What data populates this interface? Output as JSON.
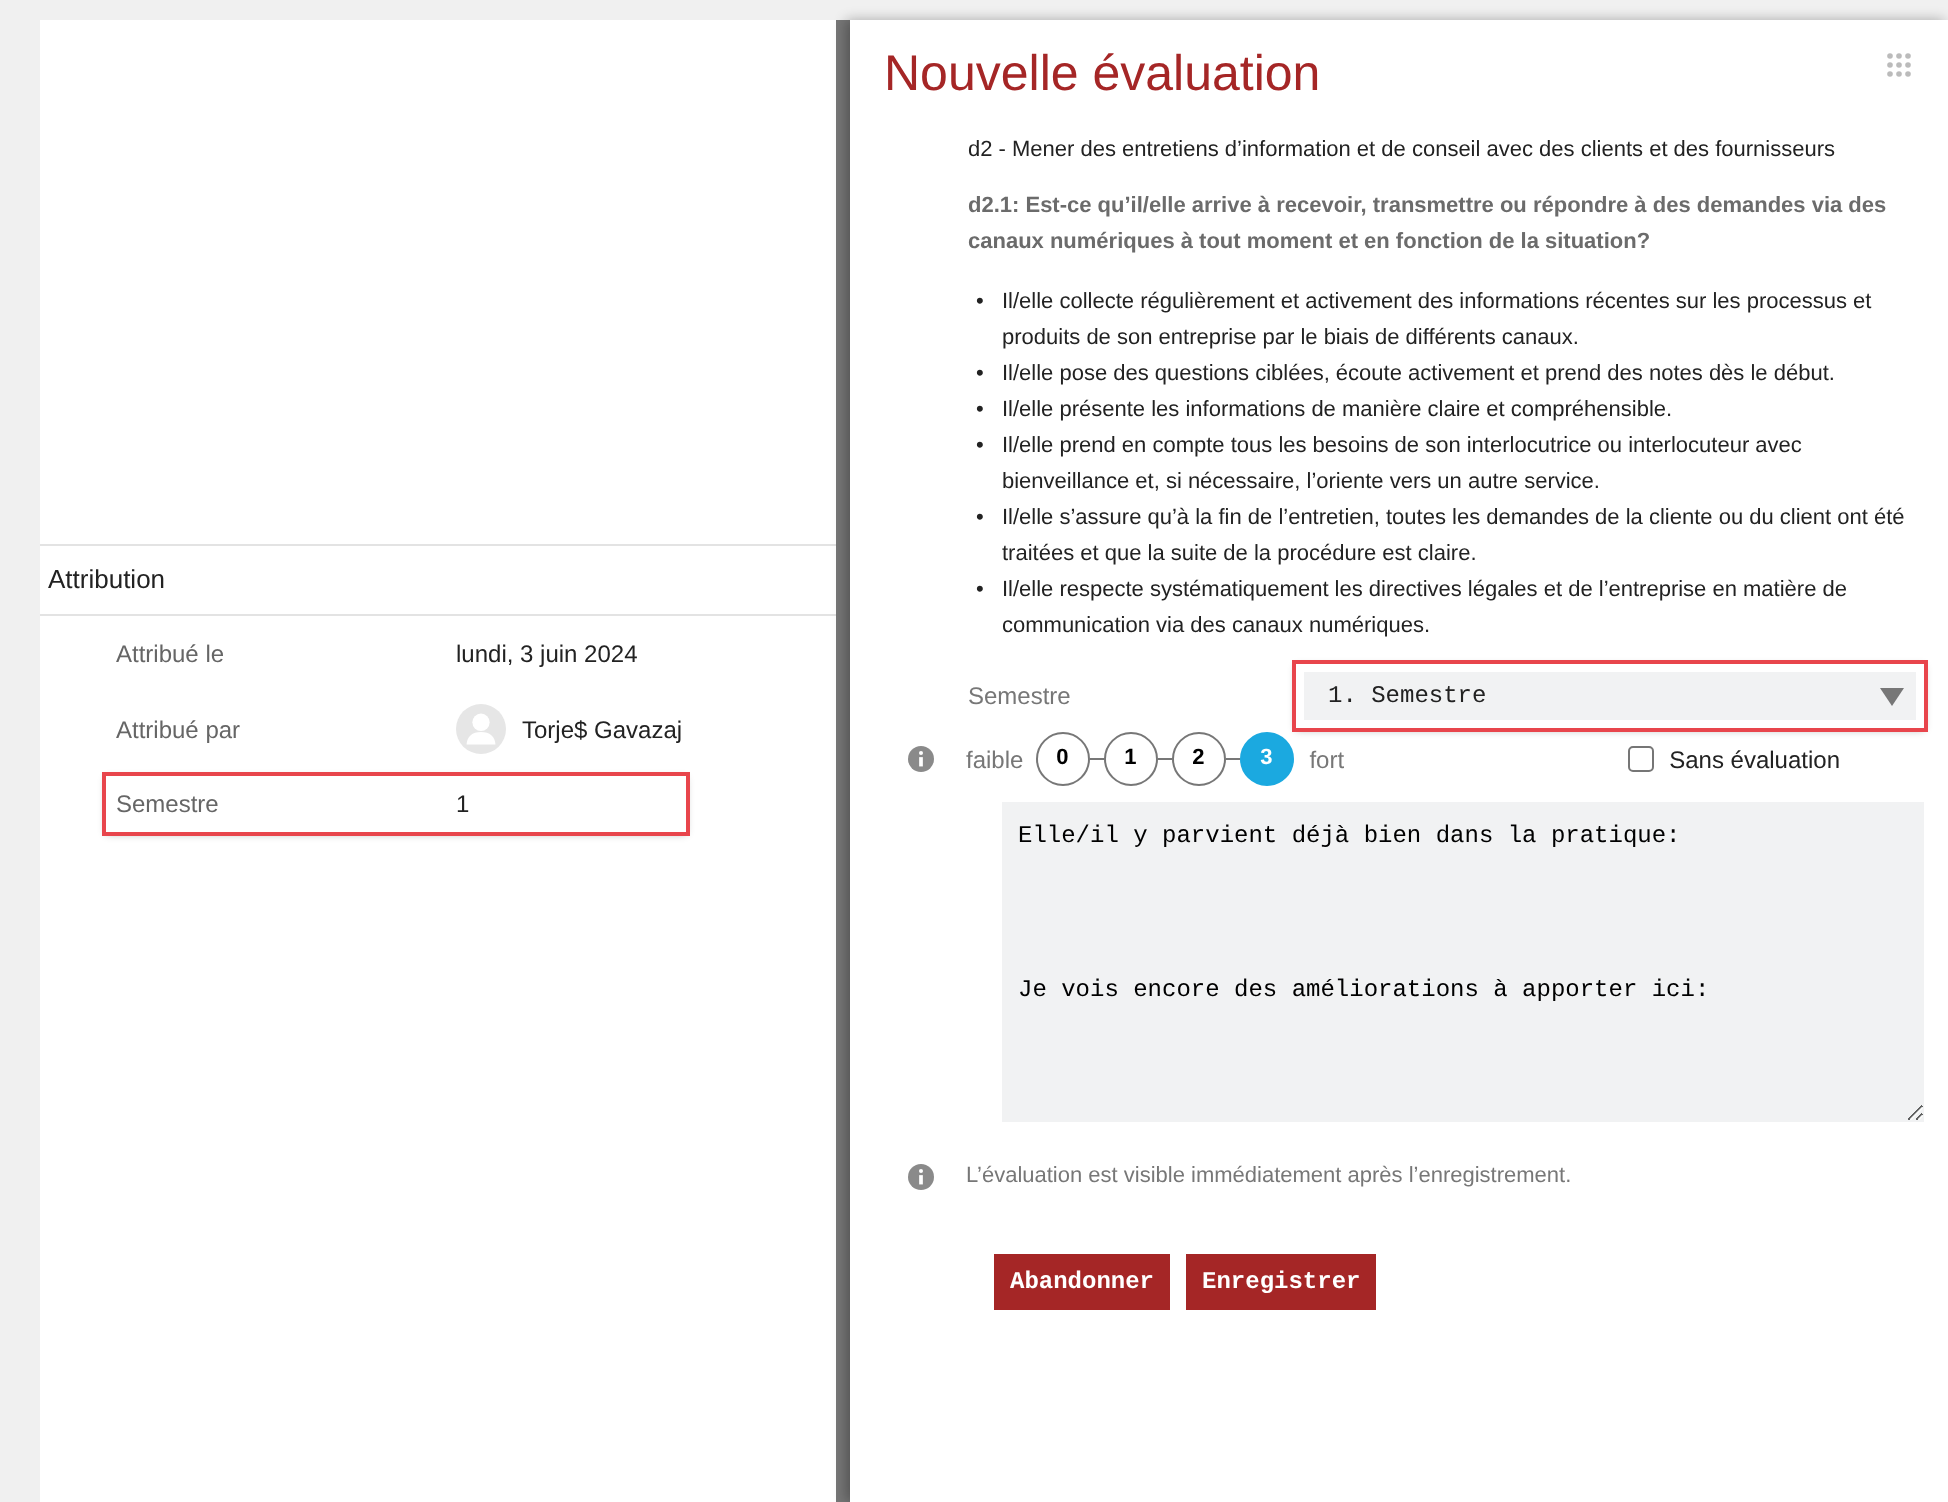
{
  "background_page": {
    "section_title": "Attribution",
    "rows": [
      {
        "label": "Attribué le",
        "value": "lundi, 3 juin 2024",
        "highlighted": false
      },
      {
        "label": "Attribué par",
        "value": "Torje$ Gavazaj",
        "kind": "person",
        "highlighted": false
      },
      {
        "label": "Semestre",
        "value": "1",
        "highlighted": true
      }
    ]
  },
  "dialog": {
    "title": "Nouvelle évaluation",
    "competence": "d2 - Mener des entretiens d’information et de conseil avec des clients et des fournisseurs",
    "question": "d2.1: Est-ce qu’il/elle arrive à recevoir, transmettre ou répondre à des demandes via des canaux numériques à tout moment et en fonction de la situation?",
    "bullet": "•",
    "criteria": [
      "Il/elle collecte régulièrement et activement des informations récentes sur les processus et produits de son entreprise par le biais de différents canaux.",
      "Il/elle pose des questions ciblées, écoute activement et prend des notes dès le début.",
      "Il/elle présente les informations de manière claire et compréhensible.",
      "Il/elle prend en compte tous les besoins de son interlocutrice ou interlocuteur avec bienveillance et, si nécessaire, l’oriente vers un autre service.",
      "Il/elle s’assure qu’à la fin de l’entretien, toutes les demandes de la cliente ou du client ont été traitées et que la suite de la procédure est claire.",
      "Il/elle respecte systématiquement les directives légales et de l’entreprise en matière de communication via des canaux numériques."
    ],
    "semester": {
      "label": "Semestre",
      "value": "1. Semestre",
      "highlighted": true
    },
    "scale": {
      "low_label": "faible",
      "high_label": "fort",
      "steps": [
        {
          "label": "0",
          "selected": false
        },
        {
          "label": "1",
          "selected": false
        },
        {
          "label": "2",
          "selected": false
        },
        {
          "label": "3",
          "selected": true
        }
      ]
    },
    "no_rating": {
      "label": "Sans évaluation",
      "checked": false
    },
    "comment": "Elle/il y parvient déjà bien dans la pratique:\n\n\n\nJe vois encore des améliorations à apporter ici:",
    "note": "L’évaluation est visible immédiatement après l’enregistrement.",
    "buttons": [
      "Abandonner",
      "Enregistrer"
    ]
  }
}
